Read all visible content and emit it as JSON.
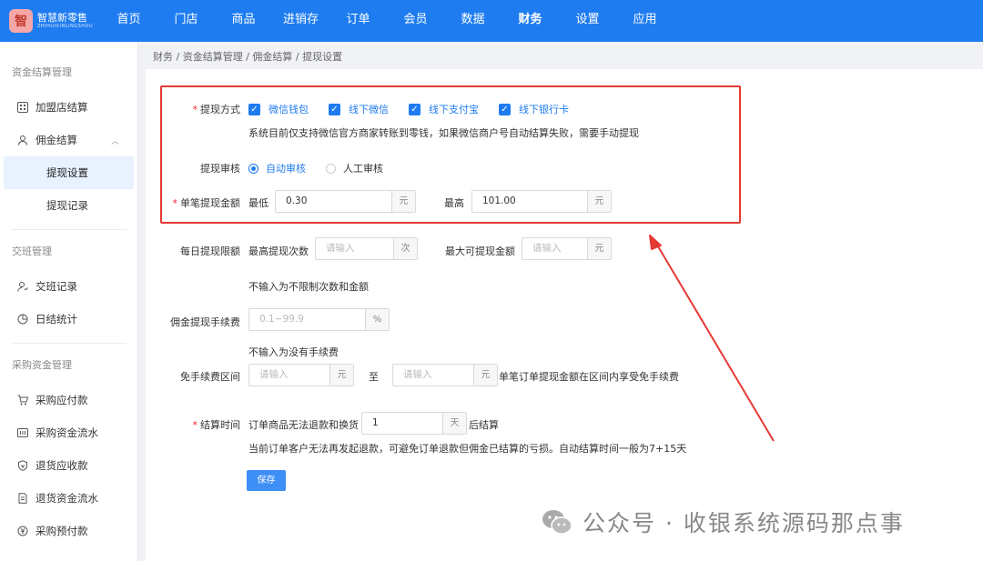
{
  "logo": {
    "name": "智慧新零售",
    "subtitle": "ZHIHUIXINLINGSHOU"
  },
  "nav": [
    "首页",
    "门店",
    "商品",
    "进销存",
    "订单",
    "会员",
    "数据",
    "财务",
    "设置",
    "应用"
  ],
  "nav_active": "财务",
  "sidebar": {
    "group1": "资金结算管理",
    "item_franchise": "加盟店结算",
    "item_commission": "佣金结算",
    "sub_withdraw_settings": "提现设置",
    "sub_withdraw_records": "提现记录",
    "group2": "交班管理",
    "item_shift_records": "交班记录",
    "item_daily_stats": "日结统计",
    "group3": "采购资金管理",
    "item_payable": "采购应付款",
    "item_fund_flow": "采购资金流水",
    "item_return_receivable": "退货应收款",
    "item_return_flow": "退货资金流水",
    "item_prepay": "采购预付款"
  },
  "breadcrumb": "财务 / 资金结算管理 / 佣金结算 / 提现设置",
  "form": {
    "method_label": "提现方式",
    "methods": [
      "微信钱包",
      "线下微信",
      "线下支付宝",
      "线下银行卡"
    ],
    "method_hint": "系统目前仅支持微信官方商家转账到零钱，如果微信商户号自动结算失败，需要手动提现",
    "audit_label": "提现审核",
    "audit_auto": "自动审核",
    "audit_manual": "人工审核",
    "single_label": "单笔提现金额",
    "min_label": "最低",
    "min_value": "0.30",
    "max_label": "最高",
    "max_value": "101.00",
    "unit_yuan": "元",
    "daily_label": "每日提现限额",
    "max_times_label": "最高提现次数",
    "input_placeholder": "请输入",
    "unit_times": "次",
    "max_amount_label": "最大可提现金额",
    "daily_hint": "不输入为不限制次数和金额",
    "fee_label": "佣金提现手续费",
    "fee_placeholder": "0.1~99.9",
    "unit_percent": "%",
    "fee_hint": "不输入为没有手续费",
    "free_label": "免手续费区间",
    "to_label": "至",
    "free_hint": "单笔订单提现金额在区间内享受免手续费",
    "settle_label": "结算时间",
    "settle_prefix": "订单商品无法退款和换货",
    "settle_value": "1",
    "unit_day": "天",
    "settle_suffix": "后结算",
    "settle_hint": "当前订单客户无法再发起退款，可避免订单退款但佣金已结算的亏损。自动结算时间一般为7+15天",
    "save": "保存"
  },
  "watermark": "公众号 · 收银系统源码那点事",
  "colors": {
    "primary": "#1f7cf0",
    "highlight": "#e53935",
    "required": "#f5222d"
  }
}
